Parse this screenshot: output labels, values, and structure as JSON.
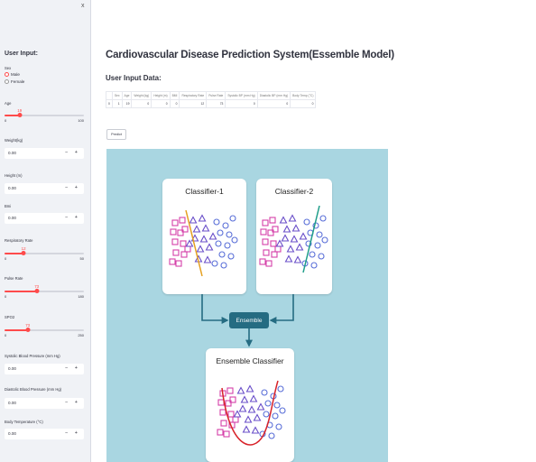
{
  "sidebar": {
    "close": "x",
    "title": "User Input:",
    "sex": {
      "label": "Sex",
      "options": [
        "Male",
        "Female"
      ],
      "selected": "Male"
    },
    "age": {
      "label": "Age",
      "value": 19,
      "min": "0",
      "max": "100"
    },
    "weight": {
      "label": "Weight(kg)",
      "value": "0.00"
    },
    "height": {
      "label": "Height (m)",
      "value": "0.00"
    },
    "bmi": {
      "label": "Bmi",
      "value": "0.00"
    },
    "respiratory": {
      "label": "Respiratory Rate",
      "value": 12,
      "min": "0",
      "max": "50"
    },
    "pulse": {
      "label": "Pulse Rate",
      "value": 73,
      "min": "0",
      "max": "180"
    },
    "spo2": {
      "label": "SPO2",
      "value": 73,
      "min": "0",
      "max": "250"
    },
    "systolic": {
      "label": "Systolic Blood Pressure (mm Hg)",
      "value": "0.00"
    },
    "diastolic": {
      "label": "Diastolic Blood Pressure (mm Hg)",
      "value": "0.00"
    },
    "body_temp": {
      "label": "Body Temperature (°C)",
      "value": "0.00"
    },
    "stepper": "− +"
  },
  "main": {
    "title": "Cardiovascular Disease Prediction System(Essemble Model)",
    "subheader": "User Input Data:",
    "table": {
      "headers": [
        "",
        "Sex",
        "Age",
        "Weight (kg)",
        "Height (m)",
        "BMI",
        "Respiratory Rate",
        "Pulse Rate",
        "Systolic BP (mm Hg)",
        "Diastolic BP (mm Hg)",
        "Body Temp (°C)"
      ],
      "rows": [
        [
          "0",
          "1",
          "19",
          "0",
          "0",
          "0",
          "12",
          "73",
          "0",
          "0",
          "0"
        ]
      ]
    },
    "predict": "Predict"
  },
  "diagram": {
    "classifier1": "Classifier-1",
    "classifier2": "Classifier-2",
    "ensemble": "Ensemble",
    "ensemble_classifier": "Ensemble Classifier"
  },
  "colors": {
    "accent": "#ff4b4b",
    "diagram_bg": "#a9d6e1",
    "ensemble_box": "#256c82",
    "square": "#d43fa8",
    "triangle": "#6a4fc9",
    "circle": "#5a6fd8",
    "line1": "#e5a020",
    "line2": "#1f9e8a",
    "curve": "#d8232a"
  },
  "icons": [
    "close-icon",
    "radio-selected-icon",
    "radio-unselected-icon",
    "minus-icon",
    "plus-icon",
    "arrow-icon"
  ]
}
